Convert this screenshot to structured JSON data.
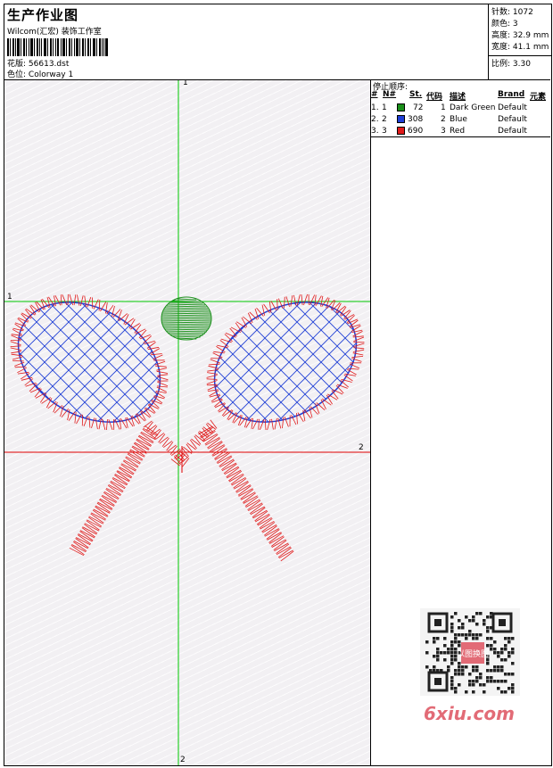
{
  "header": {
    "title": "生产作业图",
    "company": "Wilcom(汇宏) 装饰工作室",
    "design_label": "花版:",
    "design_value": "56613.dst",
    "colorway_label": "色位:",
    "colorway_value": "Colorway 1"
  },
  "stats": {
    "stitches_label": "针数:",
    "stitches_value": "1072",
    "colors_label": "颜色:",
    "colors_value": "3",
    "height_label": "高度:",
    "height_value": "32.9 mm",
    "width_label": "宽度:",
    "width_value": "41.1 mm",
    "scale_label": "比例:",
    "scale_value": "3.30"
  },
  "stop_sequence": {
    "title": "停止顺序:",
    "columns": [
      "#",
      "N#",
      "St.",
      "代码",
      "描述",
      "Brand",
      "元素"
    ],
    "rows": [
      {
        "index": "1.",
        "n": "1",
        "swatch": "#1a8f1a",
        "stitches": "72",
        "code": "1",
        "description": "Dark Green",
        "brand": "Default"
      },
      {
        "index": "2.",
        "n": "2",
        "swatch": "#1f3fd6",
        "stitches": "308",
        "code": "2",
        "description": "Blue",
        "brand": "Default"
      },
      {
        "index": "3.",
        "n": "3",
        "swatch": "#e01a1a",
        "stitches": "690",
        "code": "3",
        "description": "Red",
        "brand": "Default"
      }
    ]
  },
  "canvas": {
    "axis_labels": {
      "v_top": "1",
      "v_bottom": "2",
      "h_left": "1",
      "h_right": "2"
    },
    "guide_colors": {
      "green": "#00c800",
      "red": "#e00000"
    }
  },
  "watermark": {
    "text": "6xiu.com",
    "qr_text": "以图换图"
  }
}
